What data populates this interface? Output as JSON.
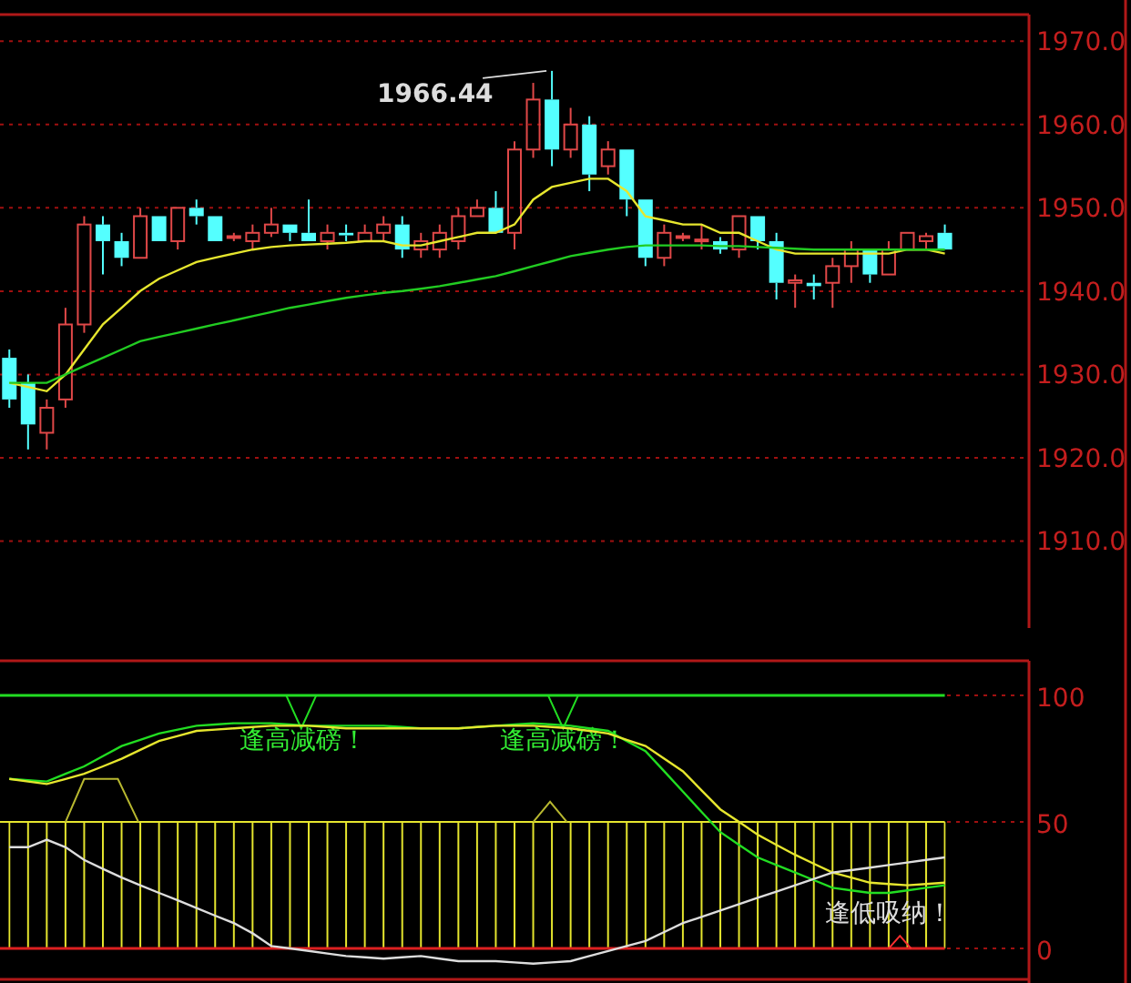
{
  "price_chart": {
    "chart_data": {
      "type": "candlestick",
      "ohlc": [
        [
          1932,
          1933,
          1926,
          1927
        ],
        [
          1929,
          1930,
          1921,
          1924
        ],
        [
          1923,
          1927,
          1921,
          1926
        ],
        [
          1927,
          1938,
          1926,
          1936
        ],
        [
          1936,
          1949,
          1935,
          1948
        ],
        [
          1948,
          1949,
          1942,
          1946
        ],
        [
          1946,
          1947,
          1943,
          1944
        ],
        [
          1944,
          1950,
          1944,
          1949
        ],
        [
          1949,
          1949,
          1946,
          1946
        ],
        [
          1946,
          1950,
          1945,
          1950
        ],
        [
          1950,
          1951,
          1948,
          1949
        ],
        [
          1949,
          1949,
          1946,
          1946
        ],
        [
          1946.4,
          1947,
          1946,
          1946.6
        ],
        [
          1946,
          1948,
          1945,
          1947
        ],
        [
          1947,
          1950,
          1946.5,
          1948
        ],
        [
          1948,
          1948,
          1946,
          1947
        ],
        [
          1947,
          1951,
          1946,
          1946
        ],
        [
          1946,
          1948,
          1945,
          1947
        ],
        [
          1947,
          1948,
          1946,
          1946.7
        ],
        [
          1946,
          1948,
          1946,
          1947
        ],
        [
          1947,
          1949,
          1946,
          1948
        ],
        [
          1948,
          1949,
          1944,
          1945
        ],
        [
          1945,
          1947,
          1944,
          1946
        ],
        [
          1945,
          1948,
          1944,
          1947
        ],
        [
          1946,
          1950,
          1945,
          1949
        ],
        [
          1949,
          1951,
          1949,
          1950
        ],
        [
          1950,
          1952,
          1947,
          1947
        ],
        [
          1947,
          1958,
          1945,
          1957
        ],
        [
          1957,
          1965,
          1956,
          1963
        ],
        [
          1963,
          1966.44,
          1955,
          1957
        ],
        [
          1957,
          1962,
          1956,
          1960
        ],
        [
          1960,
          1961,
          1952,
          1954
        ],
        [
          1955,
          1958,
          1954,
          1957
        ],
        [
          1957,
          1957,
          1949,
          1951
        ],
        [
          1951,
          1951,
          1943,
          1944
        ],
        [
          1944,
          1948,
          1943,
          1947
        ],
        [
          1946.4,
          1947,
          1946,
          1946.6
        ],
        [
          1946,
          1948,
          1945,
          1946.2
        ],
        [
          1946,
          1946.5,
          1944.5,
          1945
        ],
        [
          1945,
          1949,
          1944,
          1949
        ],
        [
          1949,
          1949,
          1945,
          1946
        ],
        [
          1946,
          1947,
          1939,
          1941
        ],
        [
          1941,
          1942,
          1938,
          1941.3
        ],
        [
          1941,
          1942,
          1939,
          1940.6
        ],
        [
          1941,
          1944,
          1938,
          1943
        ],
        [
          1943,
          1946,
          1941,
          1945
        ],
        [
          1945,
          1945,
          1941,
          1942
        ],
        [
          1942,
          1946,
          1942,
          1945
        ],
        [
          1945,
          1947,
          1945,
          1947
        ],
        [
          1946,
          1947,
          1945,
          1946.6
        ],
        [
          1947,
          1948,
          1945,
          1945
        ],
        null,
        null,
        null,
        null
      ],
      "series": [
        {
          "type": "line",
          "color": "#e6e62e",
          "values": [
            1929,
            1928.5,
            1928,
            1930,
            1933,
            1936,
            1938,
            1940,
            1941.5,
            1942.5,
            1943.5,
            1944,
            1944.5,
            1945,
            1945.3,
            1945.5,
            1945.6,
            1945.7,
            1945.8,
            1946,
            1946,
            1945.5,
            1945.5,
            1946,
            1946.5,
            1947,
            1947,
            1948,
            1951,
            1952.5,
            1953,
            1953.5,
            1953.5,
            1952,
            1949,
            1948.5,
            1948,
            1948,
            1947,
            1947,
            1946,
            1945,
            1944.5,
            1944.5,
            1944.5,
            1944.5,
            1944.5,
            1944.5,
            1945,
            1945,
            1944.5,
            null,
            null,
            null,
            null
          ]
        },
        {
          "type": "line",
          "color": "#22cc22",
          "values": [
            1929,
            1929,
            1929,
            1930,
            1931,
            1932,
            1933,
            1934,
            1934.5,
            1935,
            1935.5,
            1936,
            1936.5,
            1937,
            1937.5,
            1938,
            1938.4,
            1938.8,
            1939.2,
            1939.5,
            1939.8,
            1940,
            1940.3,
            1940.6,
            1941,
            1941.4,
            1941.8,
            1942.4,
            1943,
            1943.6,
            1944.2,
            1944.6,
            1945,
            1945.3,
            1945.5,
            1945.5,
            1945.5,
            1945.5,
            1945.4,
            1945.4,
            1945.3,
            1945.2,
            1945.1,
            1945,
            1945,
            1945,
            1945,
            1945,
            1945,
            1945,
            1945,
            null,
            null,
            null,
            null
          ]
        }
      ],
      "ylim": [
        1900,
        1973.2
      ],
      "grid": true,
      "yticks": [
        {
          "value": 1970,
          "label": "1970.0"
        },
        {
          "value": 1960,
          "label": "1960.0"
        },
        {
          "value": 1950,
          "label": "1950.0"
        },
        {
          "value": 1940,
          "label": "1940.0"
        },
        {
          "value": 1930,
          "label": "1930.0"
        },
        {
          "value": 1920,
          "label": "1920.0"
        },
        {
          "value": 1910,
          "label": "1910.0"
        }
      ],
      "annotations": [
        "1966.44"
      ]
    }
  },
  "indicator_chart": {
    "chart_data": {
      "type": "line",
      "series": [
        {
          "color": "#22dd22",
          "values": [
            67,
            66.5,
            66,
            69,
            72,
            76,
            80,
            82.5,
            85,
            86.5,
            88,
            88.5,
            89,
            89,
            89,
            88.5,
            88,
            88,
            88,
            88,
            88,
            87.5,
            87,
            87,
            87,
            87.5,
            88,
            88.5,
            89,
            88.5,
            88,
            87,
            86,
            82,
            78,
            70,
            62,
            54,
            46,
            41,
            36,
            33,
            30,
            27,
            24,
            23,
            22,
            22,
            23,
            24,
            25,
            null,
            null,
            null,
            null
          ]
        },
        {
          "color": "#e6e62e",
          "values": [
            67,
            66,
            65,
            67,
            69,
            72,
            75,
            78.5,
            82,
            84,
            86,
            86.5,
            87,
            87.5,
            88,
            88,
            88,
            87.5,
            87,
            87,
            87,
            87,
            87,
            87,
            87,
            87.5,
            88,
            88,
            88,
            87.5,
            87,
            86,
            85,
            82.5,
            80,
            75,
            70,
            62.5,
            55,
            50,
            45,
            41,
            37,
            33.5,
            30,
            28,
            26,
            25.5,
            25,
            25.5,
            26,
            null,
            null,
            null,
            null
          ]
        },
        {
          "color": "#dddddd",
          "values": [
            40,
            40,
            43,
            40,
            35,
            31.5,
            28,
            25,
            22,
            19,
            16,
            13,
            10,
            6,
            1,
            0,
            -1,
            -2,
            -3,
            -3.5,
            -4,
            -3.5,
            -3,
            -4,
            -5,
            -5,
            -5,
            -5.5,
            -6,
            -5.5,
            -5,
            -3,
            -1,
            1,
            3,
            6.5,
            10,
            12.5,
            15,
            17.5,
            20,
            22.5,
            25,
            27.5,
            30,
            31,
            32,
            33,
            34,
            35,
            36,
            null,
            null,
            null,
            null
          ]
        }
      ],
      "ylim": [
        -12.2,
        113.7
      ],
      "yticks": [
        100,
        50,
        0
      ],
      "grid": true,
      "ref_lines": [
        {
          "axis": "y",
          "value": 100,
          "color": "#22dd22"
        },
        {
          "axis": "y",
          "value": 50,
          "color": "#e6e62e"
        },
        {
          "axis": "y",
          "value": 0,
          "color": "#dd2020"
        }
      ],
      "bands": [
        {
          "axis": "y",
          "from": 0,
          "to": 50,
          "color": "#e6e62e"
        }
      ],
      "annotations": [
        "逢高减磅！",
        "逢高减磅！",
        "逢低吸纳！"
      ]
    }
  }
}
